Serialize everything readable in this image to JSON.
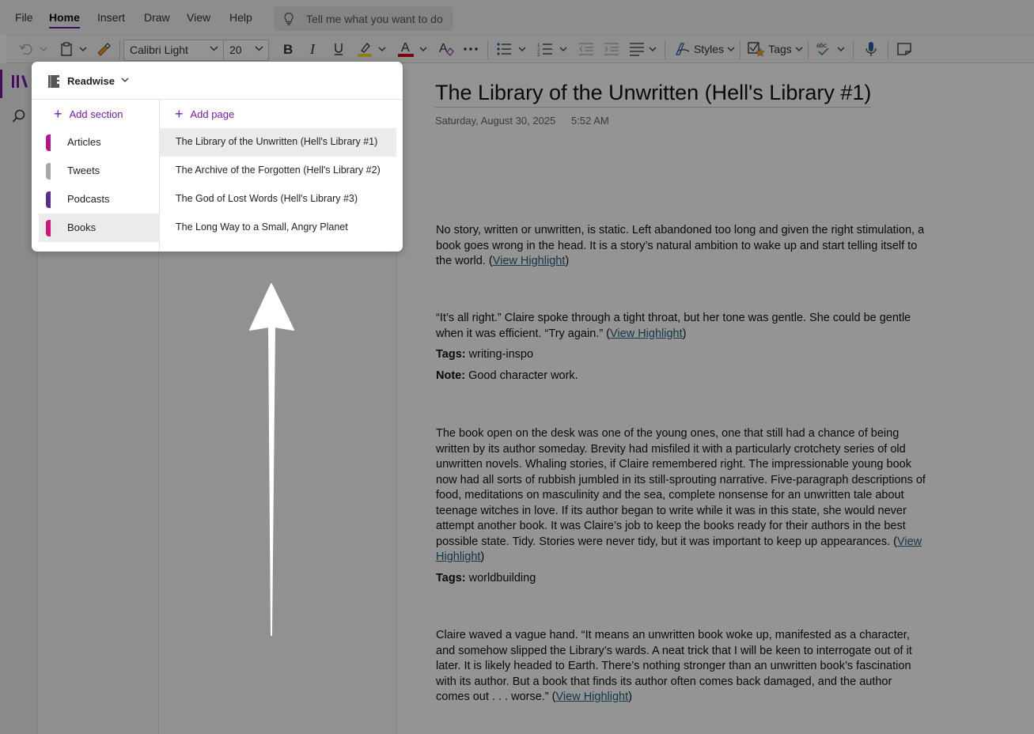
{
  "menu": {
    "file": "File",
    "home": "Home",
    "insert": "Insert",
    "draw": "Draw",
    "view": "View",
    "help": "Help",
    "tell_me": "Tell me what you want to do"
  },
  "ribbon": {
    "font_name": "Calibri Light",
    "font_size": "20",
    "styles": "Styles",
    "tags": "Tags",
    "highlight_color": "#f0e000",
    "font_color": "#d0021b"
  },
  "notebook": {
    "name": "Readwise",
    "add_section": "Add section",
    "add_page": "Add page",
    "sections": [
      {
        "label": "Articles",
        "color": "#b5168b"
      },
      {
        "label": "Tweets",
        "color": "#a8a8a8"
      },
      {
        "label": "Podcasts",
        "color": "#5b2d91"
      },
      {
        "label": "Books",
        "color": "#d0137e"
      }
    ],
    "selected_section": "Books",
    "pages": [
      "The Library of the Unwritten (Hell's Library #1)",
      "The Archive of the Forgotten (Hell's Library #2)",
      "The God of Lost Words (Hell's Library #3)",
      "The Long Way to a Small, Angry Planet"
    ]
  },
  "page": {
    "title": "The Library of the Unwritten (Hell's Library #1)",
    "date": "Saturday, August 30, 2025",
    "time": "5:52 AM",
    "link_text": "View Highlight",
    "tags_label": "Tags:",
    "note_label": "Note:",
    "h1_text": "No story, written or unwritten, is static. Left abandoned too long and given the right stimulation, a book goes wrong in the head. It is a story’s natural ambition to wake up and start telling itself to the world. (",
    "h2_text": "“It’s all right.” Claire spoke through a tight throat, but her tone was gentle. She could be gentle when it was efficient. “Try again.” (",
    "h2_tags": "writing-inspo",
    "h2_note": "Good character work.",
    "h3_text": "The book open on the desk was one of the young ones, one that still had a chance of being written by its author someday. Brevity had misfiled it with a particularly crotchety series of old unwritten novels. Whaling stories, if Claire remembered right. The impressionable young book now had all sorts of rubbish jumbled in its still-sprouting narrative. Five-paragraph descriptions of food, meditations on masculinity and the sea, complete nonsense for an unwritten tale about teenage witches in love. If its author began to write while it was in this state, she would never attempt another book. It was Claire’s job to keep the books ready for their authors in the best possible state. Tidy. Stories were never tidy, but it was important to keep up appearances. (",
    "h3_tags": "worldbuilding",
    "h4_text": "Claire waved a vague hand. “It means an unwritten book woke up, manifested as a character, and somehow slipped the Library’s wards. A neat trick that I will be keen to interrogate out of it later. It is likely headed to Earth. There’s nothing stronger than an unwritten book’s fascination with its author. But a book that finds its author often comes back damaged, and the author comes out . . . worse.” (",
    "close_paren": ")"
  },
  "icons": {
    "undo": "undo-icon",
    "paste": "clipboard-icon",
    "format_painter": "format-painter-icon",
    "bold": "bold-icon",
    "italic": "italic-icon",
    "underline": "underline-icon",
    "highlight": "highlighter-icon",
    "font_color": "font-color-icon",
    "clear_format": "clear-formatting-icon",
    "more": "more-icon",
    "bullets": "bullet-list-icon",
    "numbering": "numbered-list-icon",
    "outdent": "decrease-indent-icon",
    "indent": "increase-indent-icon",
    "align": "align-icon",
    "spell": "spelling-icon",
    "dictate": "microphone-icon",
    "sticky": "sticky-note-icon",
    "notebooks": "notebooks-icon",
    "search": "search-icon",
    "lightbulb": "lightbulb-icon"
  }
}
